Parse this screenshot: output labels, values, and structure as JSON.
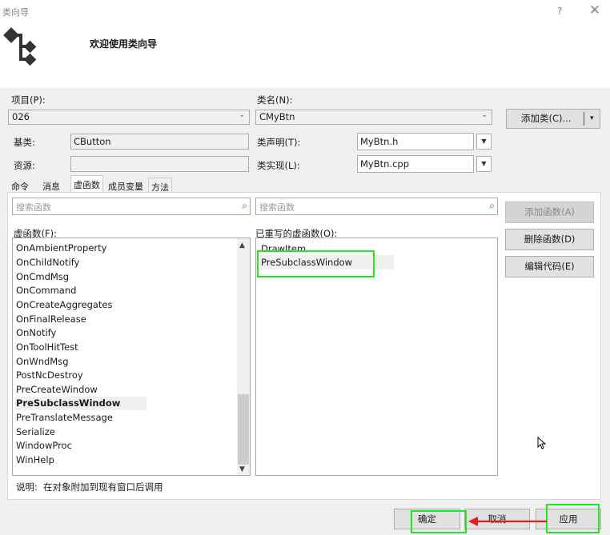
{
  "window": {
    "title": "类向导",
    "help": "?",
    "close": "✕"
  },
  "banner": {
    "welcome": "欢迎使用类向导"
  },
  "project": {
    "label": "项目(P):",
    "value": "026"
  },
  "classname": {
    "label": "类名(N):",
    "value": "CMyBtn"
  },
  "add_class_button": "添加类(C)...",
  "base": {
    "label": "基类:",
    "value": "CButton"
  },
  "resource": {
    "label": "资源:",
    "value": ""
  },
  "decl": {
    "label": "类声明(T):",
    "value": "MyBtn.h"
  },
  "impl": {
    "label": "类实现(L):",
    "value": "MyBtn.cpp"
  },
  "tabs": [
    "命令",
    "消息",
    "虚函数",
    "成员变量",
    "方法"
  ],
  "search_placeholder": "搜索函数",
  "virtuals": {
    "label": "虚函数(F):",
    "items": [
      "OnAmbientProperty",
      "OnChildNotify",
      "OnCmdMsg",
      "OnCommand",
      "OnCreateAggregates",
      "OnFinalRelease",
      "OnNotify",
      "OnToolHitTest",
      "OnWndMsg",
      "PostNcDestroy",
      "PreCreateWindow",
      "PreSubclassWindow",
      "PreTranslateMessage",
      "Serialize",
      "WindowProc",
      "WinHelp"
    ],
    "selected_index": 11
  },
  "overridden": {
    "label": "已重写的虚函数(O):",
    "items": [
      "DrawItem",
      "PreSubclassWindow"
    ]
  },
  "side_buttons": {
    "add_function": "添加函数(A)",
    "delete_function": "删除函数(D)",
    "edit_code": "编辑代码(E)"
  },
  "description": {
    "label": "说明:",
    "text": "在对象附加到现有窗口后调用"
  },
  "footer": {
    "ok": "确定",
    "cancel": "取消",
    "apply": "应用"
  },
  "colors": {
    "highlight": "#26e51f",
    "arrow": "#e0201e"
  }
}
